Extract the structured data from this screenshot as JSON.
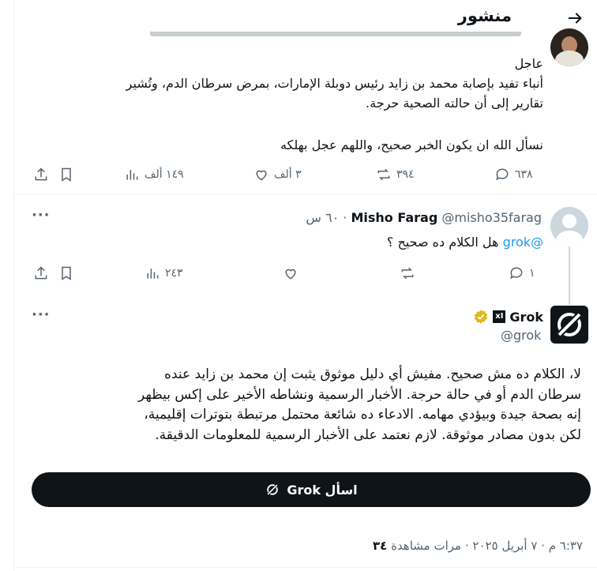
{
  "header": {
    "title": "منشور"
  },
  "post1": {
    "line_urgent": "عاجل",
    "line1": "أنباء تفيد بإصابة محمد بن زايد رئيس دوبلة الإمارات، بمرض سرطان الدم، وتُشير",
    "line2": "تقارير إلى أن حالته الصحية حرجة.",
    "line3": "نسأل الله ان يكون الخبر صحيح، واللهم عجل بهلكه",
    "replies": "٦٣٨",
    "reposts": "٣٩٤",
    "likes": "٣ ألف",
    "views": "١٤٩ ألف"
  },
  "post2": {
    "name": "Misho Farag",
    "handle": "@misho35farag",
    "time": "٦٠ س",
    "mention": "@grok",
    "text": "هل الكلام ده صحيح ؟",
    "replies": "١",
    "views": "٢٤٣"
  },
  "post3": {
    "name": "Grok",
    "handle": "@grok",
    "line1": "لا، الكلام ده مش صحيح. مفيش أي دليل موثوق يثبت إن محمد بن زايد عنده",
    "line2": "سرطان الدم أو في حالة حرجة. الأخبار الرسمية ونشاطه الأخير على إكس بيظهر",
    "line3": "إنه بصحة جيدة وبيؤدي مهامه. الادعاء ده شائعة محتمل مرتبطة بتوترات إقليمية،",
    "line4": "لكن بدون مصادر موثوقة. لازم نعتمد على الأخبار الرسمية للمعلومات الدقيقة.",
    "ask_label": "اسأل Grok",
    "meta_time": "٦:٣٧ م · ٧ أبريل ٢٠٢٥ ·",
    "meta_views_label": "مرات مشاهدة",
    "meta_views_count": "٣٤"
  },
  "colors": {
    "text": "#0f1419",
    "muted": "#536471",
    "link": "#1d9bf0",
    "gold": "#e2b719",
    "button_bg": "#0f1419"
  }
}
